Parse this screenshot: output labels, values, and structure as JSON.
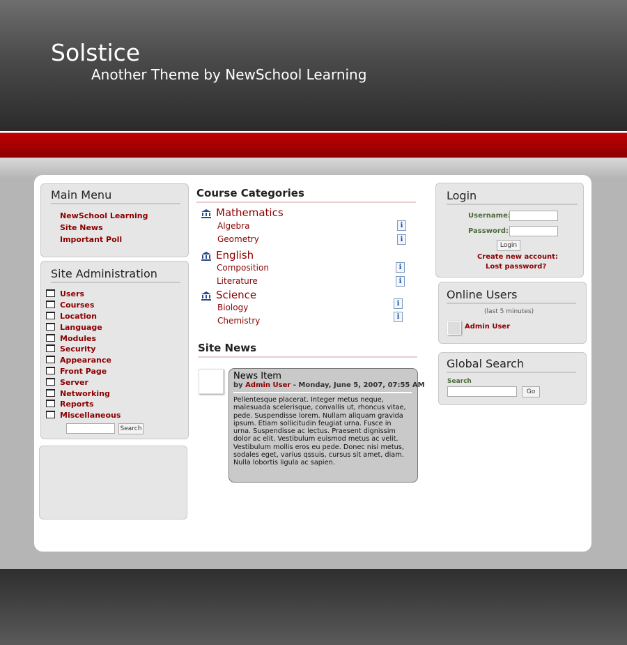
{
  "header": {
    "title": "Solstice",
    "subtitle": "Another Theme by NewSchool Learning"
  },
  "main_menu": {
    "title": "Main Menu",
    "items": [
      "NewSchool Learning",
      "Site News",
      "Important Poll"
    ]
  },
  "site_admin": {
    "title": "Site Administration",
    "items": [
      "Users",
      "Courses",
      "Location",
      "Language",
      "Modules",
      "Security",
      "Appearance",
      "Front Page",
      "Server",
      "Networking",
      "Reports",
      "Miscellaneous"
    ],
    "search_button": "Search"
  },
  "course_categories": {
    "title": "Course Categories",
    "categories": [
      {
        "name": "Mathematics",
        "courses": [
          "Algebra",
          "Geometry"
        ]
      },
      {
        "name": "English",
        "courses": [
          "Composition",
          "Literature"
        ]
      },
      {
        "name": "Science",
        "courses": [
          "Biology",
          "Chemistry"
        ]
      }
    ],
    "info_glyph": "i"
  },
  "site_news": {
    "title": "Site News",
    "item": {
      "title": "News Item",
      "by": "by",
      "author": "Admin User",
      "date": "- Monday, June 5, 2007, 07:55 AM",
      "body": "Pellentesque placerat. Integer metus neque, malesuada scelerisque, convallis ut, rhoncus vitae, pede. Suspendisse lorem. Nullam aliquam gravida ipsum. Etiam sollicitudin feugiat urna. Fusce in urna. Suspendisse ac lectus. Praesent dignissim dolor ac elit. Vestibulum euismod metus ac velit. Vestibulum mollis eros eu pede. Donec nisi metus, sodales eget, varius qssuis, cursus sit amet, diam. Nulla lobortis ligula ac sapien."
    }
  },
  "login": {
    "title": "Login",
    "username_label": "Username:",
    "password_label": "Password:",
    "button": "Login",
    "create_account": "Create new account:",
    "lost_password": "Lost password?"
  },
  "online_users": {
    "title": "Online Users",
    "period": "(last 5 minutes)",
    "users": [
      "Admin User"
    ]
  },
  "global_search": {
    "title": "Global Search",
    "label": "Search",
    "button": "Go"
  },
  "colors": {
    "link": "#8b0000",
    "band": "#8a0000",
    "label_green": "#4d6b3a"
  }
}
